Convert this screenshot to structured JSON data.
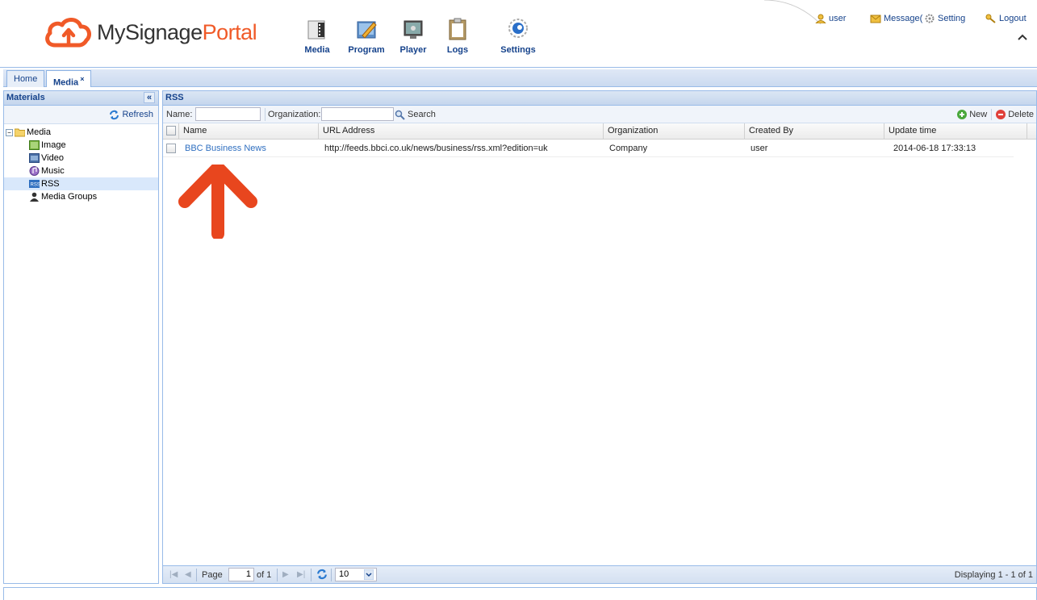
{
  "header": {
    "logo_part1": "MySignage",
    "logo_part2": "Portal",
    "nav": [
      {
        "label": "Media",
        "icon": "film-icon"
      },
      {
        "label": "Program",
        "icon": "pencil-board-icon"
      },
      {
        "label": "Player",
        "icon": "monitor-icon"
      },
      {
        "label": "Logs",
        "icon": "clipboard-icon"
      },
      {
        "label": "Settings",
        "icon": "settings-globe-icon"
      }
    ],
    "user_label": "user",
    "message_label": "Message(",
    "setting_label": "Setting",
    "logout_label": "Logout",
    "collapse_glyph": "^"
  },
  "tabs": [
    {
      "label": "Home",
      "active": false
    },
    {
      "label": "Media",
      "active": true,
      "close": "×"
    }
  ],
  "left_panel": {
    "title": "Materials",
    "collapse_glyph": "«",
    "refresh_label": "Refresh",
    "tree": {
      "root": "Media",
      "root_expander": "−",
      "children": [
        {
          "label": "Image",
          "icon": "image-icon",
          "selected": false
        },
        {
          "label": "Video",
          "icon": "video-icon",
          "selected": false
        },
        {
          "label": "Music",
          "icon": "music-icon",
          "selected": false
        },
        {
          "label": "RSS",
          "icon": "rss-icon",
          "selected": true
        },
        {
          "label": "Media Groups",
          "icon": "user-group-icon",
          "selected": false
        }
      ]
    }
  },
  "main_panel": {
    "title": "RSS",
    "filter": {
      "name_label": "Name:",
      "name_value": "",
      "org_label": "Organization:",
      "org_value": "",
      "search_label": "Search"
    },
    "new_label": "New",
    "delete_label": "Delete",
    "columns": [
      "Name",
      "URL Address",
      "Organization",
      "Created By",
      "Update time"
    ],
    "rows": [
      {
        "name": "BBC Business News",
        "url": "http://feeds.bbci.co.uk/news/business/rss.xml?edition=uk",
        "organization": "Company",
        "created_by": "user",
        "update_time": "2014-06-18 17:33:13"
      }
    ],
    "pager": {
      "page_label": "Page",
      "page_value": "1",
      "of_label": "of 1",
      "page_size": "10",
      "displaying": "Displaying 1 - 1 of 1"
    }
  },
  "colors": {
    "accent": "#15428b",
    "brand_orange": "#f05a28",
    "border": "#99bbe8",
    "annotation_arrow": "#e8461e"
  }
}
